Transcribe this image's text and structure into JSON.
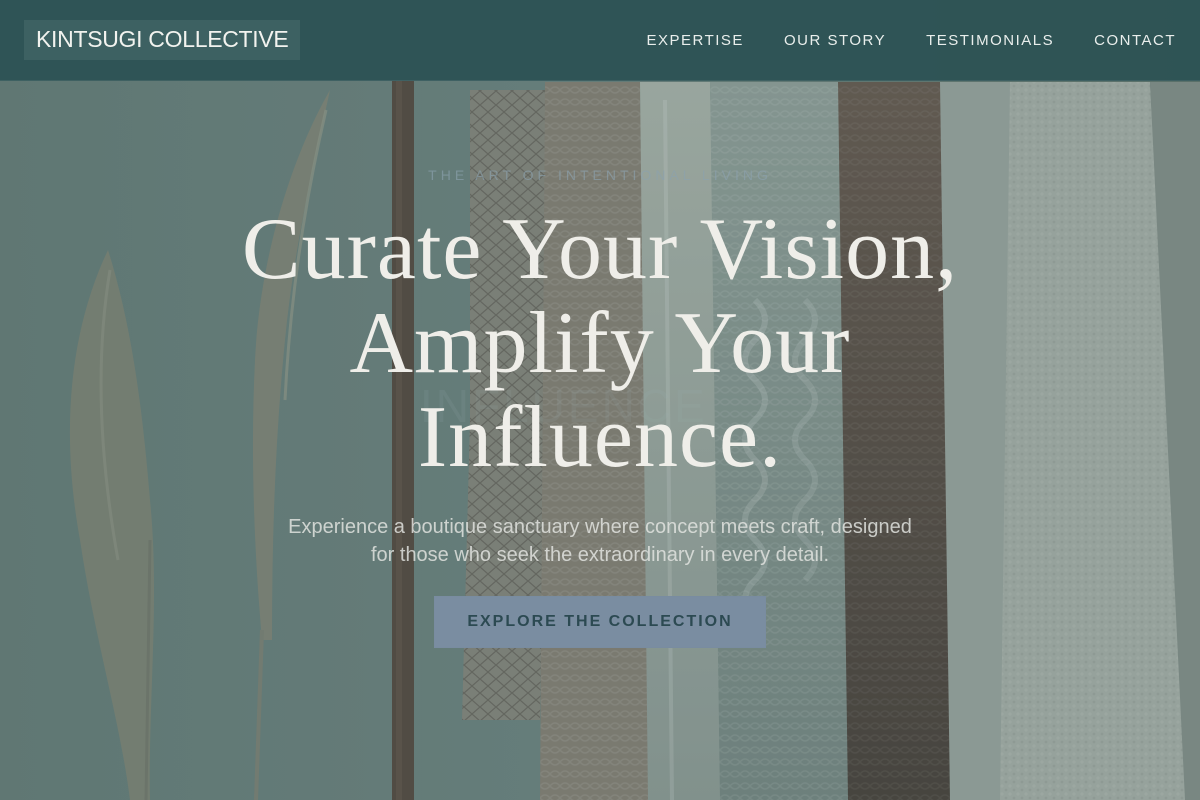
{
  "brand": {
    "name": "KINTSUGI COLLECTIVE"
  },
  "nav": {
    "items": [
      {
        "label": "EXPERTISE"
      },
      {
        "label": "OUR STORY"
      },
      {
        "label": "TESTIMONIALS"
      },
      {
        "label": "CONTACT"
      }
    ]
  },
  "hero": {
    "eyebrow": "THE ART OF INTENTIONAL LIVING",
    "headline_lines": [
      "Curate Your Vision,",
      "Amplify Your",
      "Influence."
    ],
    "ghost_text": "INFLUENCE",
    "subtitle_lines": [
      "Experience a boutique sanctuary where concept meets craft, designed",
      "for those who seek the extraordinary in every detail."
    ],
    "cta_label": "EXPLORE THE COLLECTION"
  },
  "colors": {
    "nav_background": "#2c5254",
    "headline": "#efeee9",
    "cta_background": "#7a8da1",
    "cta_text": "#2c4a52"
  },
  "icons": {
    "backdrop": "clothing-rack-with-pampas-grass-photo"
  }
}
